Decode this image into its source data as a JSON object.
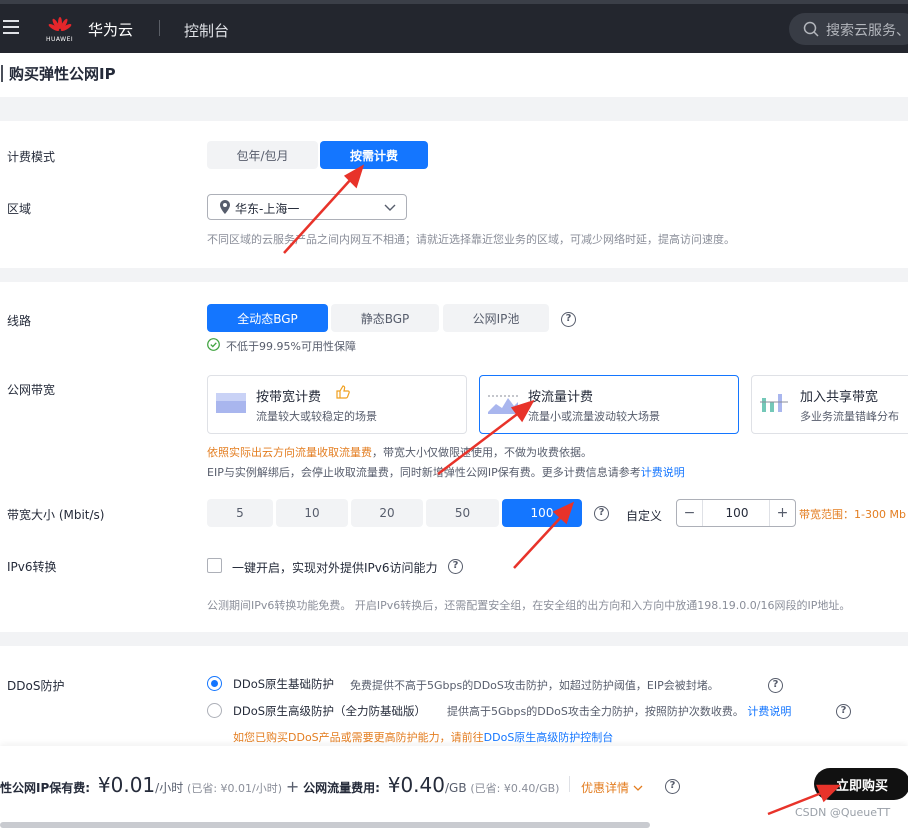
{
  "topbar": {
    "logo_text": "HUAWEI",
    "brand": "华为云",
    "console": "控制台",
    "search_placeholder": "搜索云服务、"
  },
  "page_title": "购买弹性公网IP",
  "billing": {
    "label": "计费模式",
    "options": [
      "包年/包月",
      "按需计费"
    ],
    "selected": "按需计费"
  },
  "region": {
    "label": "区域",
    "value": "华东-上海一",
    "hint": "不同区域的云服务产品之间内网互不相通；请就近选择靠近您业务的区域，可减少网络时延，提高访问速度。"
  },
  "line": {
    "label": "线路",
    "options": [
      "全动态BGP",
      "静态BGP",
      "公网IP池"
    ],
    "selected": "全动态BGP",
    "guarantee": "不低于99.95%可用性保障"
  },
  "bandwidth_type": {
    "label": "公网带宽",
    "cards": [
      {
        "title": "按带宽计费",
        "sub": "流量较大或较稳定的场景"
      },
      {
        "title": "按流量计费",
        "sub": "流量小或流量波动较大场景"
      },
      {
        "title": "加入共享带宽",
        "sub": "多业务流量错峰分布"
      }
    ],
    "selected": "按流量计费",
    "warn": "依照实际出云方向流量收取流量费",
    "note1_rest": "，带宽大小仅做限速使用，不做为收费依据。",
    "note2": "EIP与实例解绑后，会停止收取流量费，同时新增弹性公网IP保有费。更多计费信息请参考",
    "note2_link": "计费说明"
  },
  "bandwidth_size": {
    "label": "带宽大小 (Mbit/s)",
    "options": [
      "5",
      "10",
      "20",
      "50",
      "100"
    ],
    "selected": "100",
    "custom_label": "自定义",
    "custom_value": "100",
    "minus": "−",
    "plus": "+",
    "range": "带宽范围：1-300 Mb"
  },
  "ipv6": {
    "label": "IPv6转换",
    "checkbox_label": "一键开启，实现对外提供IPv6访问能力",
    "checked": false,
    "hint": "公测期间IPv6转换功能免费。 开启IPv6转换后，还需配置安全组，在安全组的出方向和入方向中放通198.19.0.0/16网段的IP地址。"
  },
  "ddos": {
    "label": "DDoS防护",
    "options": [
      {
        "name": "DDoS原生基础防护",
        "desc": "免费提供不高于5Gbps的DDoS攻击防护，如超过防护阈值，EIP会被封堵。"
      },
      {
        "name": "DDoS原生高级防护（全力防基础版）",
        "desc": "提供高于5Gbps的DDoS攻击全力防护，按照防护次数收费。"
      }
    ],
    "selected": "DDoS原生基础防护",
    "desc_link": "计费说明",
    "warn": "如您已购买DDoS产品或需要更高防护能力，请前往",
    "warn_link": "DDoS原生高级防护控制台"
  },
  "footer": {
    "keep_fee_label": "性公网IP保有费:",
    "keep_fee_value": "¥0.01",
    "keep_fee_unit": "/小时",
    "keep_fee_saved": "(已省: ¥0.01/小时)",
    "plus": "+",
    "traffic_fee_label": "公网流量费用:",
    "traffic_fee_value": "¥0.40",
    "traffic_fee_unit": "/GB",
    "traffic_fee_saved": "(已省: ¥0.40/GB)",
    "discount": "优惠详情",
    "buy": "立即购买",
    "watermark": "CSDN @QueueTT"
  },
  "colors": {
    "primary": "#1476ff",
    "warn": "#e37d20",
    "topbar": "#23262e",
    "arrow": "#e8332a"
  }
}
